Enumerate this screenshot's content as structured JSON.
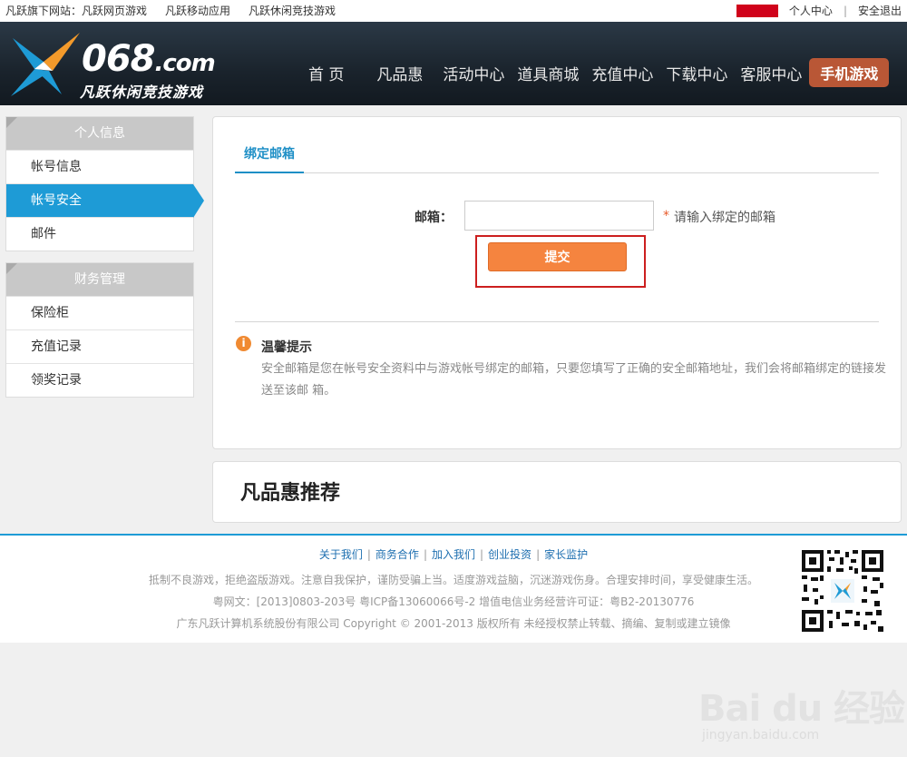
{
  "topbar": {
    "sites": [
      "凡跃旗下网站：凡跃网页游戏",
      "凡跃移动应用",
      "凡跃休闲竞技游戏"
    ],
    "personal_center": "个人中心",
    "separator": "|",
    "logout": "安全退出"
  },
  "header": {
    "logo_number": "068",
    "logo_domain": ".com",
    "logo_slogan": "凡跃休闲竞技游戏",
    "nav": [
      "首 页",
      "凡品惠",
      "活动中心",
      "道具商城",
      "充值中心",
      "下载中心",
      "客服中心"
    ],
    "nav_mobile": "手机游戏"
  },
  "sidebar": {
    "groups": [
      {
        "title": "个人信息",
        "items": [
          "帐号信息",
          "帐号安全",
          "邮件"
        ]
      },
      {
        "title": "财务管理",
        "items": [
          "保险柜",
          "充值记录",
          "领奖记录"
        ]
      }
    ],
    "active_item": "帐号安全"
  },
  "main": {
    "tab": "绑定邮箱",
    "email_label": "邮箱：",
    "email_value": "",
    "email_placeholder": "",
    "required_mark": "*",
    "email_hint": "请输入绑定的邮箱",
    "submit": "提交",
    "tip_icon": "i",
    "tip_title": "温馨提示",
    "tip_text": "安全邮箱是您在帐号安全资料中与游戏帐号绑定的邮箱，只要您填写了正确的安全邮箱地址，我们会将邮箱绑定的链接发送至该邮 箱。"
  },
  "recommend": {
    "title": "凡品惠推荐"
  },
  "footer": {
    "links": [
      "关于我们",
      "商务合作",
      "加入我们",
      "创业投资",
      "家长监护"
    ],
    "link_separator": "|",
    "line1": "抵制不良游戏，拒绝盗版游戏。注意自我保护，谨防受骗上当。适度游戏益脑，沉迷游戏伤身。合理安排时间，享受健康生活。",
    "line2": "粤网文：[2013]0803-203号 粤ICP备13060066号-2 增值电信业务经营许可证：粤B2-20130776",
    "line3": "广东凡跃计算机系统股份有限公司 Copyright © 2001-2013 版权所有 未经授权禁止转载、摘编、复制或建立镜像"
  },
  "watermark": {
    "main": "Bai du 经验",
    "sub": "jingyan.baidu.com"
  },
  "colors": {
    "accent_blue": "#1e9bd6",
    "submit_orange": "#f5843f",
    "highlight_red": "#cc1f1f",
    "mobile_button": "#b95736"
  }
}
